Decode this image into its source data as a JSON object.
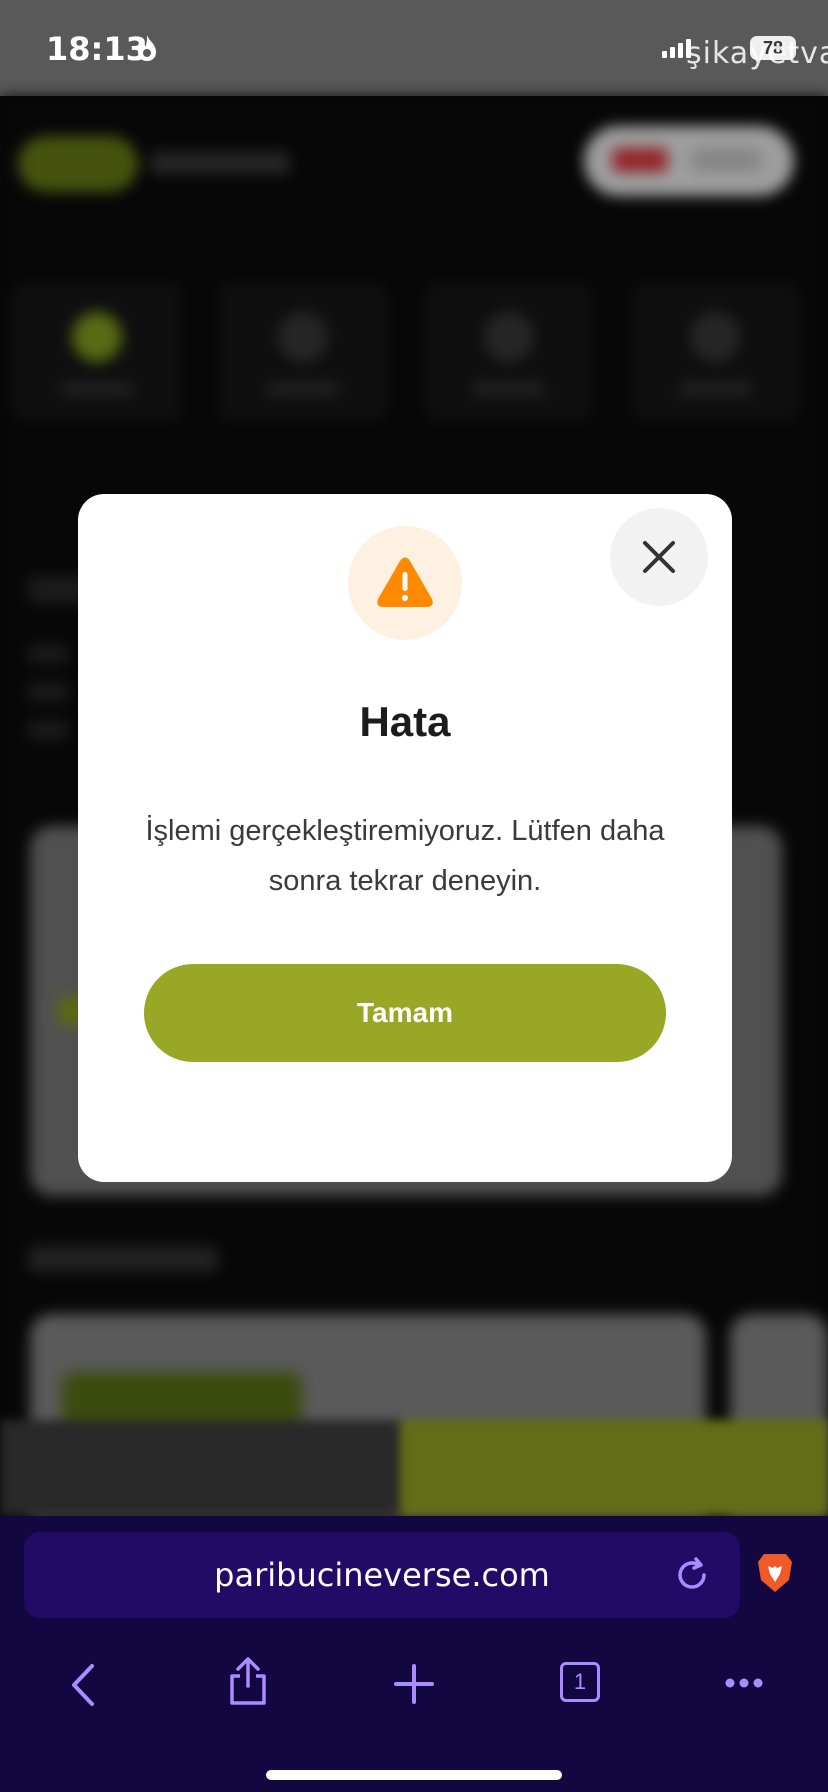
{
  "status_bar": {
    "time": "18:13",
    "watermark": "şikayetvar",
    "battery": "78"
  },
  "dialog": {
    "title": "Hata",
    "message": "İşlemi gerçekleştiremiyoruz. Lütfen daha sonra tekrar deneyin.",
    "ok_label": "Tamam",
    "icon": "warning-icon",
    "accent_color": "#99a727",
    "warning_color": "#ff8a00"
  },
  "browser": {
    "url": "paribucineverse.com",
    "tab_count": "1",
    "theme_color": "#130742"
  }
}
